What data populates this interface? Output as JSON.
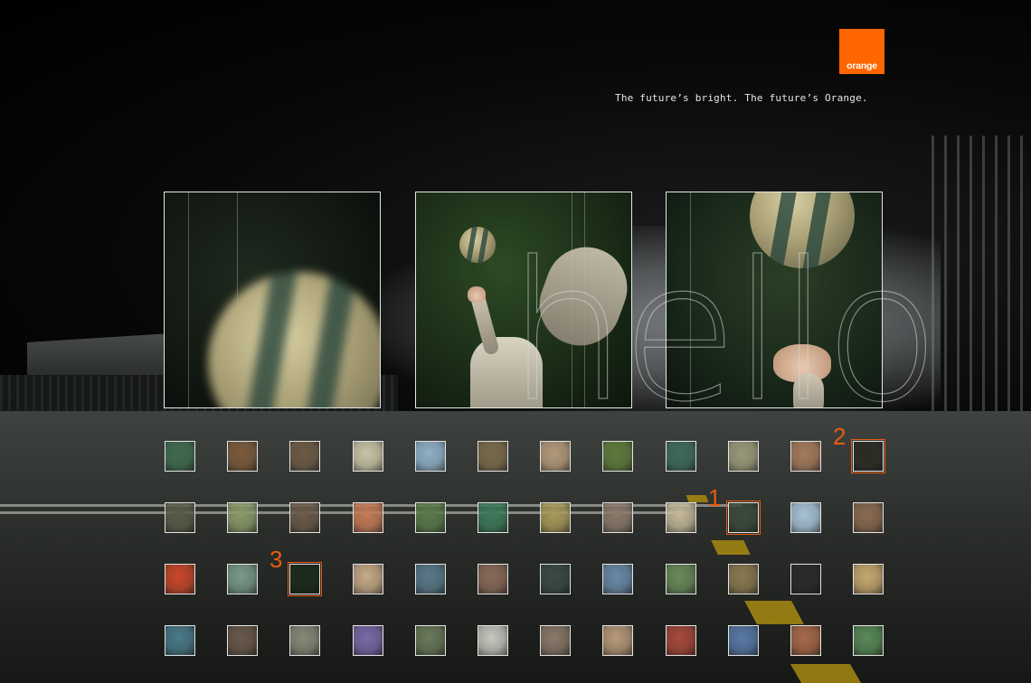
{
  "brand": {
    "logo_text": "orange",
    "logo_color": "#ff6600",
    "tagline": "The future’s bright. The future’s Orange."
  },
  "overlay_word": "hello",
  "accent_color": "#e85c0d",
  "frames": [
    {
      "id": "frame-1",
      "content": "blurred-ball-close-up"
    },
    {
      "id": "frame-2",
      "content": "person-reaching-for-ball"
    },
    {
      "id": "frame-3",
      "content": "hand-reaching-for-ball"
    }
  ],
  "markers": [
    {
      "label": "1",
      "row": 1,
      "col": 9
    },
    {
      "label": "2",
      "row": 0,
      "col": 11
    },
    {
      "label": "3",
      "row": 2,
      "col": 2
    }
  ],
  "thumbnails": [
    [
      "#3f6a4f",
      "#7a5a3a",
      "#6c5a43",
      "#c9c4a6",
      "#8fb0c8",
      "#7a6a4a",
      "#b49a7a",
      "#5e7a3a",
      "#3e6a5a",
      "#9a9a7a",
      "#a57a5a",
      "#2a2a22"
    ],
    [
      "#5a5a48",
      "#8a9a6a",
      "#6a5a4a",
      "#c47a55",
      "#5a7a4a",
      "#3c7a5a",
      "#a89a5a",
      "#8a7a6a",
      "#c4b89a",
      "#3a4a3a",
      "#a8c4d8",
      "#8a6a50"
    ],
    [
      "#c8472a",
      "#7a9a8a",
      "#1a2a1a",
      "#c8aa88",
      "#5a7a8a",
      "#8a6a5a",
      "#3a4a44",
      "#6a8aa8",
      "#6a8a5a",
      "#8a7a50",
      "#2a2a2a",
      "#c8a870"
    ],
    [
      "#4a7a8a",
      "#6a5a4a",
      "#8a8a7a",
      "#7a6aa8",
      "#6a7a5a",
      "#c8c8c0",
      "#8a7a6a",
      "#b89a7a",
      "#a84a3a",
      "#5a7aa8",
      "#a86a4a",
      "#5a8a5a"
    ]
  ]
}
